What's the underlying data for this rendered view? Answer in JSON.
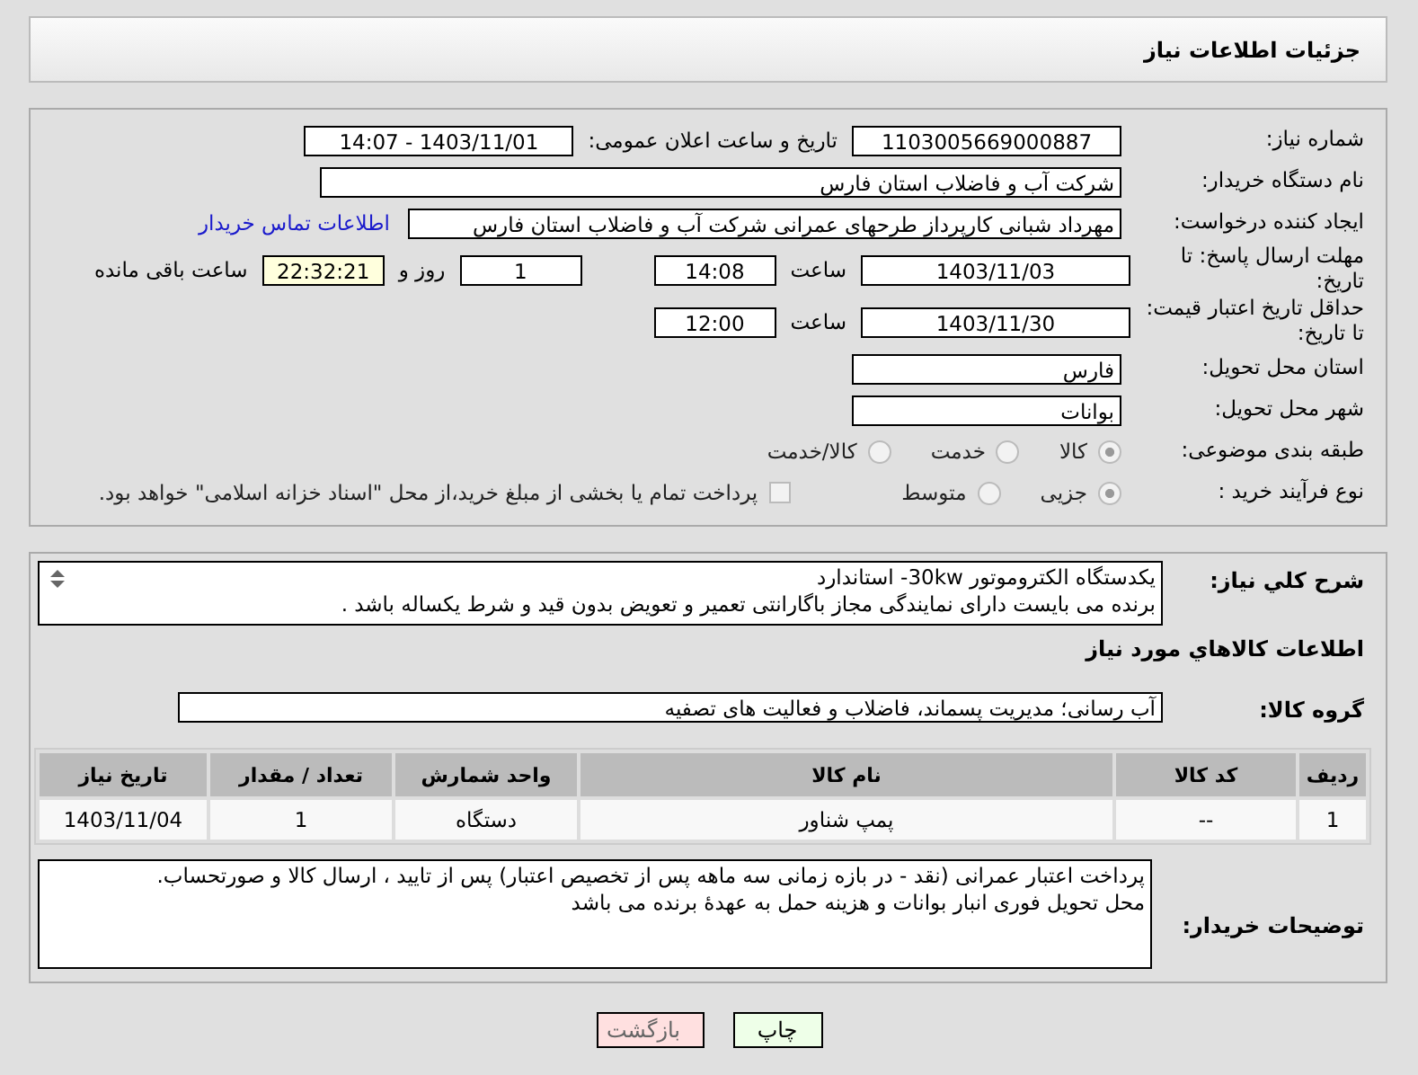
{
  "header": {
    "title": "جزئیات اطلاعات نیاز"
  },
  "need_number": {
    "label": "شماره نیاز:",
    "value": "1103005669000887"
  },
  "announce": {
    "label": "تاریخ و ساعت اعلان عمومی:",
    "value": "1403/11/01 - 14:07"
  },
  "buyer": {
    "label": "نام دستگاه خریدار:",
    "value": "شرکت آب و فاضلاب استان فارس"
  },
  "creator": {
    "label": "ایجاد کننده درخواست:",
    "value": "مهرداد شبانی کارپرداز طرحهای عمرانی  شرکت آب و فاضلاب استان فارس",
    "link": "اطلاعات تماس خریدار"
  },
  "deadline": {
    "label": "مهلت ارسال پاسخ: تا تاریخ:",
    "date": "1403/11/03",
    "time_label": "ساعت",
    "time": "14:08",
    "days": "1",
    "days_label": "روز و",
    "remaining": "22:32:21",
    "remaining_label": "ساعت باقی مانده"
  },
  "validity": {
    "label": "حداقل تاریخ اعتبار قیمت: تا تاریخ:",
    "date": "1403/11/30",
    "time_label": "ساعت",
    "time": "12:00"
  },
  "province": {
    "label": "استان محل تحویل:",
    "value": "فارس"
  },
  "city": {
    "label": "شهر محل تحویل:",
    "value": "بوانات"
  },
  "category": {
    "label": "طبقه بندی موضوعی:",
    "options": [
      {
        "label": "کالا",
        "selected": true
      },
      {
        "label": "خدمت",
        "selected": false
      },
      {
        "label": "کالا/خدمت",
        "selected": false
      }
    ]
  },
  "process": {
    "label": "نوع فرآیند خرید :",
    "options": [
      {
        "label": "جزیی",
        "selected": true
      },
      {
        "label": "متوسط",
        "selected": false
      }
    ],
    "treasury": {
      "checked": false,
      "label": "پرداخت تمام یا بخشی از مبلغ خرید،از محل \"اسناد خزانه اسلامی\" خواهد بود."
    }
  },
  "description": {
    "label": "شرح کلي نياز:",
    "lines": [
      "یکدستگاه الکتروموتور  30kw- استاندارد",
      "برنده می بایست دارای نمایندگی مجاز باگارانتی تعمیر و تعویض بدون قید و شرط یکساله باشد ."
    ]
  },
  "goods_heading": "اطلاعات کالاهاي مورد نياز",
  "goods_group": {
    "label": "گروه کالا:",
    "value": "آب رسانی؛ مدیریت پسماند، فاضلاب و فعالیت های تصفیه"
  },
  "table": {
    "columns": [
      "ردیف",
      "کد کالا",
      "نام کالا",
      "واحد شمارش",
      "تعداد / مقدار",
      "تاریخ نیاز"
    ],
    "rows": [
      [
        "1",
        "--",
        "پمپ شناور",
        "دستگاه",
        "1",
        "1403/11/04"
      ]
    ]
  },
  "buyer_notes": {
    "label": "توضیحات خریدار:",
    "lines": [
      "پرداخت اعتبار  عمرانی  (نقد - در بازه زمانی سه ماهه پس از تخصیص اعتبار) پس از تایید ، ارسال کالا  و صورتحساب.",
      "محل تحویل فوری انبار بوانات  و هزینه حمل به عهدهٔ برنده می باشد"
    ]
  },
  "buttons": [
    {
      "label": "چاپ",
      "kind": "print"
    },
    {
      "label": "بازگشت",
      "kind": "back"
    }
  ]
}
